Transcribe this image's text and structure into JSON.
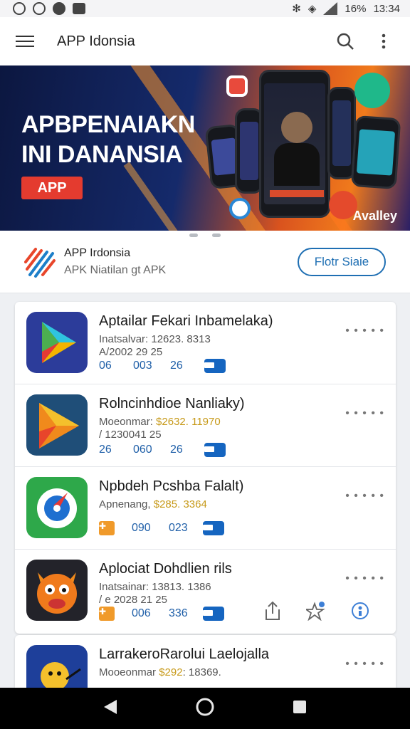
{
  "status": {
    "battery": "16%",
    "time": "13:34"
  },
  "appbar": {
    "title": "APP Idonsia"
  },
  "banner": {
    "line1": "APBPENAIAKN",
    "line2": "INI DANANSIA",
    "badge": "APP",
    "brand": "Avalley"
  },
  "info": {
    "title": "APP Irdonsia",
    "subtitle": "APK Niatilan gt APK",
    "button": "Flotr Siaie"
  },
  "apps": [
    {
      "name": "Aptailar Fekari Inbamelaka)",
      "meta1": "Inatsalvar: 12623. 8313",
      "meta2": "A/2002 29 25",
      "s1": "06",
      "s2": "003",
      "s3": "26"
    },
    {
      "name": "Rolncinhdioe Nanliaky)",
      "meta1a": "Moeonmar: ",
      "meta1b": "$2632",
      "meta1c": ". 11970",
      "meta2": "/ 1230041 25",
      "s1": "26",
      "s2": "060",
      "s3": "26"
    },
    {
      "name": "Npbdeh Pcshba Falalt)",
      "meta1a": "Apnenang, ",
      "meta1b": "$285",
      "meta1c": ". 3364",
      "s1": "090",
      "s2": "023"
    },
    {
      "name": "Aplociat Dohdlien rils",
      "meta1": "Inatsainar: 13813. 1386",
      "meta2": "/ e 2028 21 25",
      "s1": "006",
      "s2": "336"
    },
    {
      "name": "LarrakeroRarolui Laelojalla",
      "meta1a": "Mooeonmar ",
      "meta1b": "$292",
      "meta1c": ": 18369."
    }
  ],
  "more_label": "• • • • •"
}
